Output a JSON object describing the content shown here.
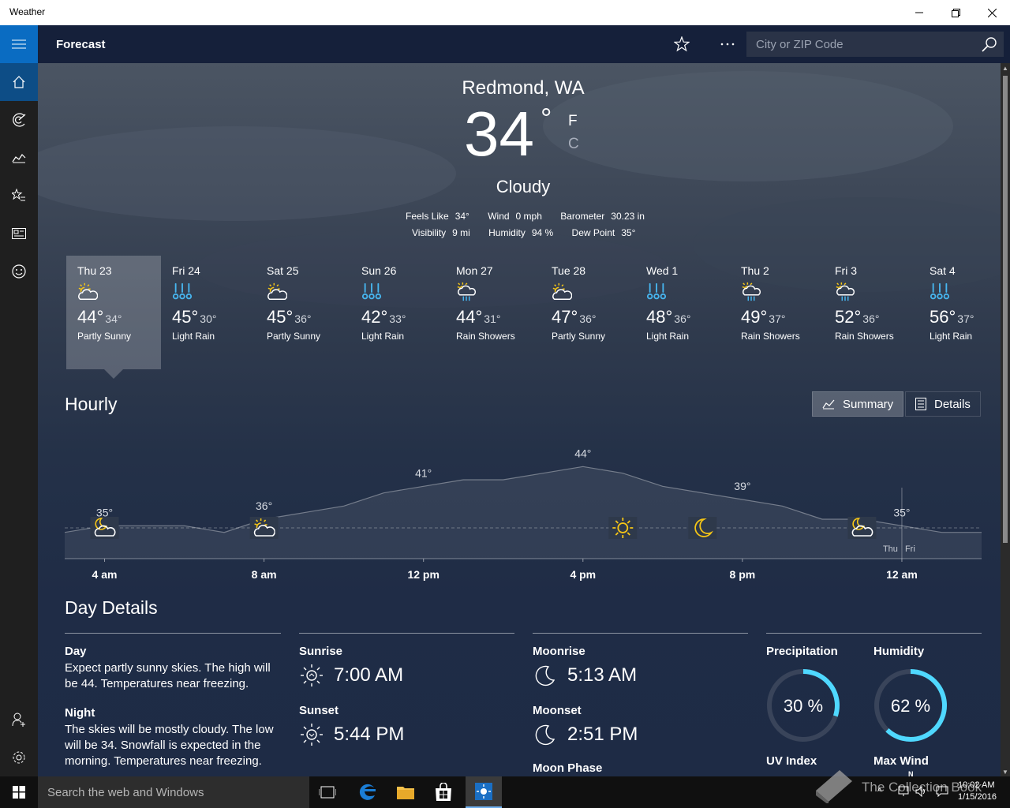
{
  "window": {
    "title": "Weather"
  },
  "appbar": {
    "section": "Forecast",
    "search_placeholder": "City or ZIP Code"
  },
  "current": {
    "location": "Redmond, WA",
    "temp": "34",
    "degree": "°",
    "unit_f": "F",
    "unit_c": "C",
    "condition": "Cloudy",
    "feels_like_label": "Feels Like",
    "feels_like": "34°",
    "wind_label": "Wind",
    "wind": "0 mph",
    "barometer_label": "Barometer",
    "barometer": "30.23 in",
    "visibility_label": "Visibility",
    "visibility": "9 mi",
    "humidity_label": "Humidity",
    "humidity": "94 %",
    "dewpoint_label": "Dew Point",
    "dewpoint": "35°"
  },
  "daily": [
    {
      "day": "Thu 23",
      "hi": "44°",
      "lo": "34°",
      "cond": "Partly Sunny",
      "icon": "partly-sunny-icon"
    },
    {
      "day": "Fri 24",
      "hi": "45°",
      "lo": "30°",
      "cond": "Light Rain",
      "icon": "light-rain-icon"
    },
    {
      "day": "Sat 25",
      "hi": "45°",
      "lo": "36°",
      "cond": "Partly Sunny",
      "icon": "partly-sunny-icon"
    },
    {
      "day": "Sun 26",
      "hi": "42°",
      "lo": "33°",
      "cond": "Light Rain",
      "icon": "light-rain-icon"
    },
    {
      "day": "Mon 27",
      "hi": "44°",
      "lo": "31°",
      "cond": "Rain Showers",
      "icon": "rain-showers-icon"
    },
    {
      "day": "Tue 28",
      "hi": "47°",
      "lo": "36°",
      "cond": "Partly Sunny",
      "icon": "partly-sunny-icon"
    },
    {
      "day": "Wed 1",
      "hi": "48°",
      "lo": "36°",
      "cond": "Light Rain",
      "icon": "light-rain-icon"
    },
    {
      "day": "Thu 2",
      "hi": "49°",
      "lo": "37°",
      "cond": "Rain Showers",
      "icon": "rain-showers-icon"
    },
    {
      "day": "Fri 3",
      "hi": "52°",
      "lo": "36°",
      "cond": "Rain Showers",
      "icon": "rain-showers-icon"
    },
    {
      "day": "Sat 4",
      "hi": "56°",
      "lo": "37°",
      "cond": "Light Rain",
      "icon": "light-rain-icon"
    }
  ],
  "hourly": {
    "title": "Hourly",
    "summary_label": "Summary",
    "details_label": "Details",
    "peak_labels": [
      "35°",
      "36°",
      "41°",
      "44°",
      "39°",
      "35°"
    ],
    "time_labels": [
      "4 am",
      "8 am",
      "12 pm",
      "4 pm",
      "8 pm",
      "12 am"
    ],
    "day_split_labels": [
      "Thu",
      "Fri"
    ],
    "icons": [
      "partly-cloudy-night-icon",
      "partly-sunny-icon",
      "sun-icon",
      "moon-icon",
      "partly-cloudy-night-icon"
    ]
  },
  "chart_data": {
    "type": "area",
    "x": [
      "3 am",
      "4 am",
      "5 am",
      "6 am",
      "7 am",
      "8 am",
      "9 am",
      "10 am",
      "11 am",
      "12 pm",
      "1 pm",
      "2 pm",
      "3 pm",
      "4 pm",
      "5 pm",
      "6 pm",
      "7 pm",
      "8 pm",
      "9 pm",
      "10 pm",
      "11 pm",
      "12 am",
      "1 am",
      "2 am"
    ],
    "values": [
      34,
      35,
      35,
      35,
      34,
      36,
      37,
      38,
      40,
      41,
      42,
      42,
      43,
      44,
      43,
      41,
      40,
      39,
      38,
      36,
      36,
      35,
      34,
      34
    ],
    "data_labels": [
      "35°",
      "36°",
      "41°",
      "44°",
      "39°",
      "35°"
    ],
    "ylim": [
      30,
      48
    ]
  },
  "day_details": {
    "title": "Day Details",
    "day_label": "Day",
    "day_text": "Expect partly sunny skies. The high will be 44. Temperatures near freezing.",
    "night_label": "Night",
    "night_text": "The skies will be mostly cloudy. The low will be 34. Snowfall is expected in the morning. Temperatures near freezing.",
    "sunrise_label": "Sunrise",
    "sunrise": "7:00 AM",
    "sunset_label": "Sunset",
    "sunset": "5:44 PM",
    "moonrise_label": "Moonrise",
    "moonrise": "5:13 AM",
    "moonset_label": "Moonset",
    "moonset": "2:51 PM",
    "moonphase_label": "Moon Phase",
    "precip_label": "Precipitation",
    "precip": "30 %",
    "precip_value": 30,
    "humidity_label": "Humidity",
    "humidity": "62 %",
    "humidity_value": 62,
    "uv_label": "UV Index",
    "maxwind_label": "Max Wind",
    "compass_n": "N"
  },
  "taskbar": {
    "search_placeholder": "Search the web and Windows",
    "time": "10:02 AM",
    "date": "1/15/2016",
    "watermark": "The Collection Book"
  },
  "colors": {
    "accent": "#0a6cc2",
    "ring": "#4fd8ff",
    "sun": "#f6c616",
    "rain": "#47b6f0"
  }
}
